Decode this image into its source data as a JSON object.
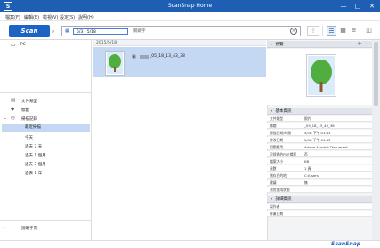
{
  "window": {
    "title": "ScanSnap Home",
    "logo": "S",
    "min": "—",
    "restore": "□",
    "close": "✕"
  },
  "menu": [
    "檔案(F)",
    "編輯(E)",
    "檢視(V)",
    "設定(S)",
    "說明(H)"
  ],
  "toolbar": {
    "scan_label": "Scan",
    "date_value": "5/3 - 5/18",
    "search_hint": "關鍵字"
  },
  "sidebar": {
    "pc_label": "PC",
    "items": [
      {
        "label": "文件類型"
      },
      {
        "label": "標籤"
      },
      {
        "label": "掃描記錄"
      },
      {
        "label": "最近掃描"
      },
      {
        "label": "今天"
      },
      {
        "label": "過去 7 天"
      },
      {
        "label": "過去 1 個月"
      },
      {
        "label": "過去 3 個月"
      },
      {
        "label": "過去 1 年"
      }
    ],
    "footer_label": "說明手冊"
  },
  "list": {
    "group_date": "2015/5/18",
    "items": [
      {
        "name": "_05_18_13_43_38"
      }
    ]
  },
  "preview_panel": {
    "title": "預覽"
  },
  "info_panel": {
    "title": "基本資訊",
    "rows": [
      {
        "k": "文件類型",
        "v": "照片"
      },
      {
        "k": "標題",
        "v": "_05_18_13_43_38"
      },
      {
        "k": "掃描日期/時間",
        "v": "5/18 下午 01:43"
      },
      {
        "k": "修改日期",
        "v": "5/18 下午 01:43"
      },
      {
        "k": "相關應用",
        "v": "Adobe Acrobat Document"
      },
      {
        "k": "可搜尋的PDF檔案",
        "v": "否"
      },
      {
        "k": "檔案大小",
        "v": "KB"
      },
      {
        "k": "頁數",
        "v": "1 頁"
      },
      {
        "k": "儲存目的地",
        "v": "C:\\Users\\"
      },
      {
        "k": "建議",
        "v": "無"
      },
      {
        "k": "瀏覽使用狀態",
        "v": ""
      }
    ]
  },
  "extra_panel": {
    "title": "詳細資訊",
    "rows": [
      {
        "k": "製作者"
      },
      {
        "k": "作業日期"
      }
    ]
  },
  "brand": "ScanSnap"
}
